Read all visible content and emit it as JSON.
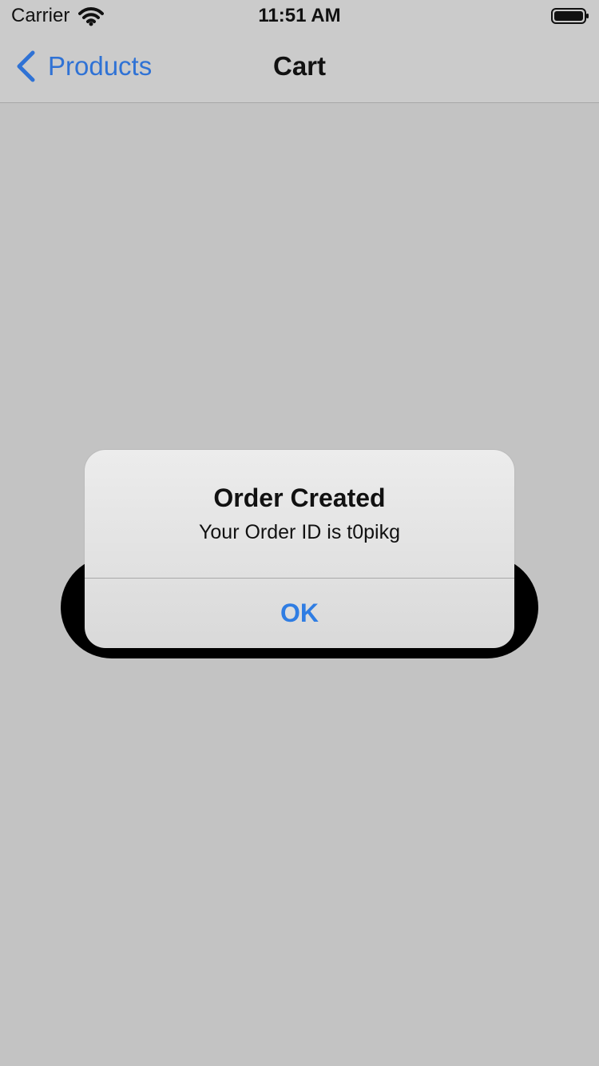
{
  "status_bar": {
    "carrier": "Carrier",
    "time": "11:51 AM",
    "wifi_icon": "wifi-icon",
    "battery_icon": "battery-icon"
  },
  "nav_bar": {
    "back_label": "Products",
    "title": "Cart",
    "back_icon": "chevron-left-icon",
    "accent_color": "#2f72d5"
  },
  "alert": {
    "title": "Order Created",
    "message": "Your Order ID is t0pikg",
    "ok_label": "OK",
    "button_color": "#2f7de3"
  },
  "theme": {
    "screen_background": "#c3c3c3",
    "nav_background": "#cbcbcb",
    "pill_background": "#000000"
  }
}
